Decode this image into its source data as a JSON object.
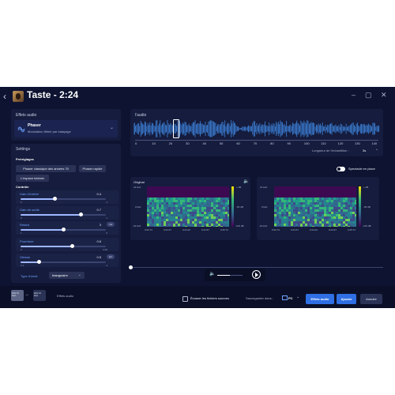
{
  "window": {
    "title": "Taste - 2:24"
  },
  "effects_panel": {
    "title": "Effets audio",
    "effect_name": "Phaser",
    "effect_desc": "Modulation filtrée par balayage"
  },
  "settings": {
    "title": "Settings",
    "presets_title": "Préréglages",
    "presets": [
      "Phaser classique des années 70",
      "Phaser rapide",
      "L'espace lointain"
    ],
    "controls_title": "Contrôle",
    "controls": [
      {
        "label": "Gain d'entrée",
        "value": "0.4",
        "min": "0",
        "max": "1",
        "level": 0.4
      },
      {
        "label": "Gain de sortie",
        "value": "0.7",
        "min": "0",
        "max": "1",
        "level": 0.7
      },
      {
        "label": "Retard",
        "value": "3",
        "unit": "ms",
        "min": "1",
        "max": "5",
        "level": 0.5
      },
      {
        "label": "Pourriture",
        "value": "0.6",
        "min": "0",
        "max": "0.99",
        "level": 0.6
      },
      {
        "label": "Vitesse",
        "value": "0.5",
        "unit": "Hz",
        "min": "0.1",
        "max": "2",
        "level": 0.21
      }
    ],
    "wave_label": "Type d'onde",
    "wave_value": "triangulaire"
  },
  "chain": {
    "node1": "WAV 16 kbps",
    "node2": "WAV 16 kbps",
    "label": "Effets audio"
  },
  "audio": {
    "title": "l'audio",
    "ticks": [
      "0",
      "10",
      "20",
      "30",
      "40",
      "50",
      "60",
      "70",
      "80",
      "90",
      "100",
      "110",
      "120",
      "130",
      "140"
    ],
    "sample_label": "Longueur de l'échantillon :",
    "sample_value": "3s"
  },
  "toggle_label": "Spectacle en place",
  "spec_left": {
    "title": "Original",
    "y_ticks": [
      "22 kHz",
      "0 kHz",
      "-22 kHz"
    ],
    "x_ticks": [
      "0:22:72",
      "0:23:47",
      "0:24:22",
      "0:24:97",
      "0:25:72"
    ],
    "cb_ticks": [
      "+ dB",
      "-50 dB",
      "-100 dB"
    ]
  },
  "spec_right": {
    "y_ticks": [
      "22 kHz",
      "0 kHz",
      "-22 kHz"
    ],
    "x_ticks": [
      "0:22:72",
      "0:23:47",
      "0:24:22",
      "0:24:97",
      "0:25:72"
    ],
    "cb_ticks": [
      "+ dB",
      "-50 dB",
      "-100 dB"
    ]
  },
  "footer": {
    "overwrite_label": "Écraser les fichiers sources",
    "save_label": "Sauvegarder dans :",
    "save_value": "PC",
    "effects_btn": "Effets audio",
    "add_btn": "Ajouter",
    "cancel_btn": "Annuler"
  },
  "colors": {
    "accent": "#2f6fe4",
    "waveform": "#3f86e0",
    "window": "#0d1330"
  }
}
